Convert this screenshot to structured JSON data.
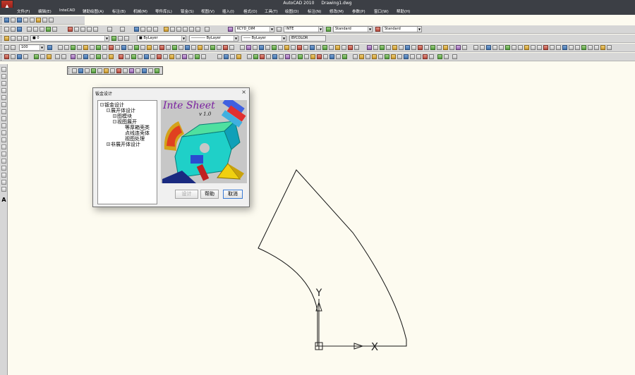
{
  "window": {
    "app_name": "AutoCAD 2010",
    "file_name": "Drawing1.dwg"
  },
  "menu": [
    "文件(F)",
    "编辑(E)",
    "InteCAD",
    "辅助绘图(A)",
    "标注(B)",
    "机械(M)",
    "零件库(L)",
    "钣金(S)",
    "视图(V)",
    "插入(I)",
    "格式(O)",
    "工具(T)",
    "绘图(D)",
    "标注(N)",
    "修改(M)",
    "参数(P)",
    "窗口(W)",
    "帮助(H)"
  ],
  "toolbar": {
    "dimstyle_value": "KCYD_DIM",
    "textstyle_value": "INTE",
    "tablestyle_value": "Standard",
    "mleaderstyle_value": "Standard",
    "layer_value": "0",
    "scale_value": "100",
    "color_value": "ByLayer",
    "linetype_value": "ByLayer",
    "lineweight_value": "ByLayer",
    "plotstyle_value": "BYCOLOR"
  },
  "lefttoolbar": {
    "text_tool_label": "A"
  },
  "dialog": {
    "title": "钣金设计",
    "close_glyph": "×",
    "tree": {
      "root": "钣金设计",
      "children": {
        "unfold": "展开体设计",
        "picture_module": "图模块",
        "view_unfold": "视图展开",
        "equal_thickness": "等厚箱壳类",
        "point_line_shell": "点线连壳体",
        "view_process": "视图处理",
        "non_unfold": "非展开体设计"
      }
    },
    "banner": {
      "title": "Inte Sheet",
      "version": "v 1.0"
    },
    "buttons": {
      "design": "设计",
      "help": "帮助",
      "cancel": "取消"
    }
  },
  "drawing": {
    "ucs_y_label": "Y",
    "ucs_x_label": "X"
  },
  "colors": {
    "canvas": "#fdfbf0",
    "titlebar": "#3c3f45",
    "toolbar": "#d6d6d6",
    "dialog_bg": "#f0f0f0",
    "banner_title": "#7a1fa0"
  }
}
